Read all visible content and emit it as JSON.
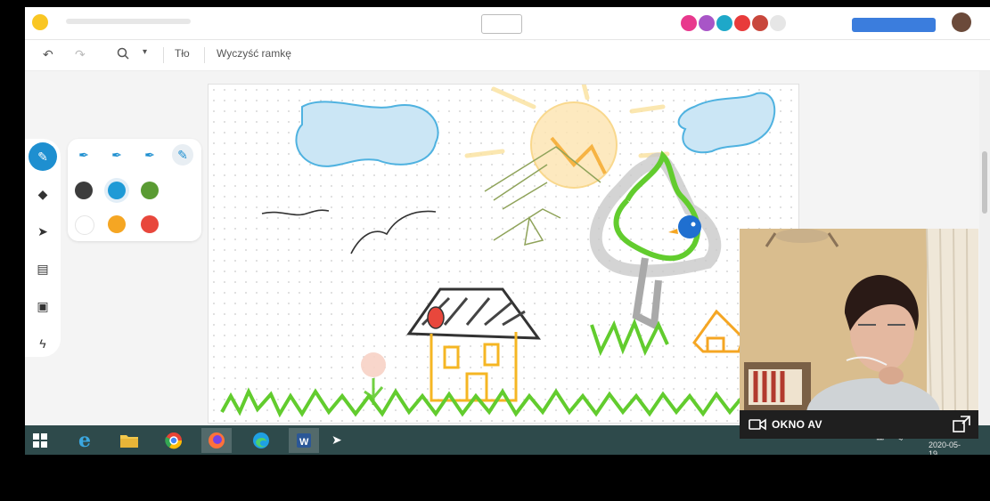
{
  "app": {
    "title": ""
  },
  "toolbar": {
    "undo_label": "undo",
    "redo_label": "redo",
    "zoom_label": "zoom",
    "background_label": "Tło",
    "clear_label": "Wyczyść ramkę"
  },
  "palette": {
    "colors": [
      "#3c3c3c",
      "#1f9ad6",
      "#5a9b33",
      "#ffffff",
      "#f5a623",
      "#e8473c"
    ]
  },
  "avatars": [
    "#e8388d",
    "#a855c7",
    "#1ea8c9",
    "#e83b3b",
    "#c8473c",
    "#e6e6e6"
  ],
  "video": {
    "label": "OKNO AV"
  },
  "taskbar": {
    "date": "2020-05-19"
  }
}
